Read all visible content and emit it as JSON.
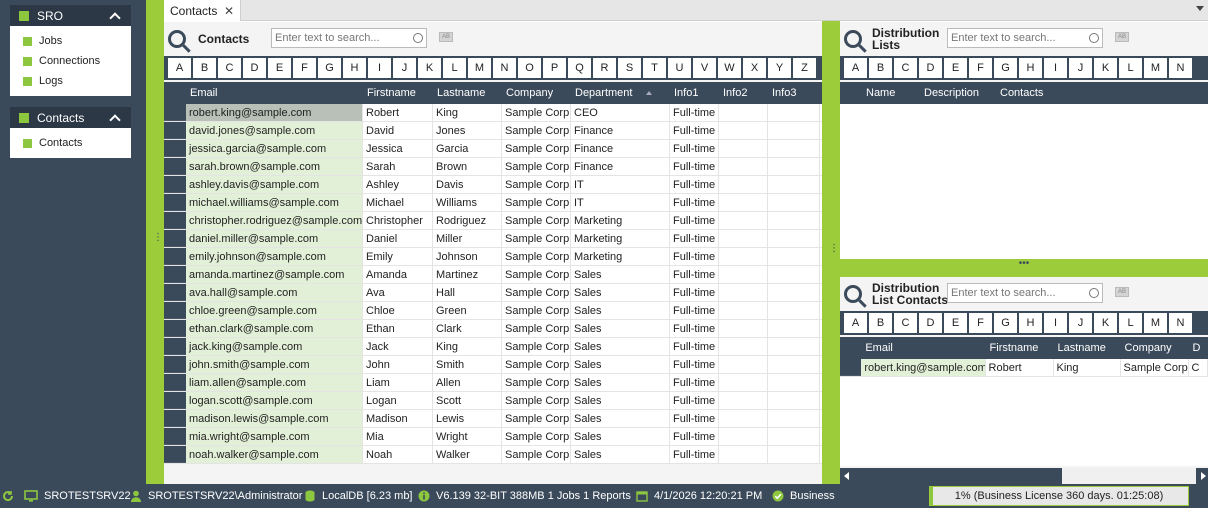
{
  "sidebar": {
    "groups": [
      {
        "title": "SRO",
        "items": [
          "Jobs",
          "Connections",
          "Logs"
        ]
      },
      {
        "title": "Contacts",
        "items": [
          "Contacts"
        ]
      }
    ]
  },
  "tabs": [
    {
      "label": "Contacts",
      "close": "✕"
    }
  ],
  "contacts_panel": {
    "title": "Contacts",
    "search_placeholder": "Enter text to search...",
    "ab": "AB",
    "letters": [
      "A",
      "B",
      "C",
      "D",
      "E",
      "F",
      "G",
      "H",
      "I",
      "J",
      "K",
      "L",
      "M",
      "N",
      "O",
      "P",
      "Q",
      "R",
      "S",
      "T",
      "U",
      "V",
      "W",
      "X",
      "Y",
      "Z"
    ],
    "columns": [
      "Email",
      "Firstname",
      "Lastname",
      "Company",
      "Department",
      "Info1",
      "Info2",
      "Info3"
    ],
    "rows": [
      [
        "robert.king@sample.com",
        "Robert",
        "King",
        "Sample Corp",
        "CEO",
        "Full-time"
      ],
      [
        "david.jones@sample.com",
        "David",
        "Jones",
        "Sample Corp",
        "Finance",
        "Full-time"
      ],
      [
        "jessica.garcia@sample.com",
        "Jessica",
        "Garcia",
        "Sample Corp",
        "Finance",
        "Full-time"
      ],
      [
        "sarah.brown@sample.com",
        "Sarah",
        "Brown",
        "Sample Corp",
        "Finance",
        "Full-time"
      ],
      [
        "ashley.davis@sample.com",
        "Ashley",
        "Davis",
        "Sample Corp",
        "IT",
        "Full-time"
      ],
      [
        "michael.williams@sample.com",
        "Michael",
        "Williams",
        "Sample Corp",
        "IT",
        "Full-time"
      ],
      [
        "christopher.rodriguez@sample.com",
        "Christopher",
        "Rodriguez",
        "Sample Corp",
        "Marketing",
        "Full-time"
      ],
      [
        "daniel.miller@sample.com",
        "Daniel",
        "Miller",
        "Sample Corp",
        "Marketing",
        "Full-time"
      ],
      [
        "emily.johnson@sample.com",
        "Emily",
        "Johnson",
        "Sample Corp",
        "Marketing",
        "Full-time"
      ],
      [
        "amanda.martinez@sample.com",
        "Amanda",
        "Martinez",
        "Sample Corp",
        "Sales",
        "Full-time"
      ],
      [
        "ava.hall@sample.com",
        "Ava",
        "Hall",
        "Sample Corp",
        "Sales",
        "Full-time"
      ],
      [
        "chloe.green@sample.com",
        "Chloe",
        "Green",
        "Sample Corp",
        "Sales",
        "Full-time"
      ],
      [
        "ethan.clark@sample.com",
        "Ethan",
        "Clark",
        "Sample Corp",
        "Sales",
        "Full-time"
      ],
      [
        "jack.king@sample.com",
        "Jack",
        "King",
        "Sample Corp",
        "Sales",
        "Full-time"
      ],
      [
        "john.smith@sample.com",
        "John",
        "Smith",
        "Sample Corp",
        "Sales",
        "Full-time"
      ],
      [
        "liam.allen@sample.com",
        "Liam",
        "Allen",
        "Sample Corp",
        "Sales",
        "Full-time"
      ],
      [
        "logan.scott@sample.com",
        "Logan",
        "Scott",
        "Sample Corp",
        "Sales",
        "Full-time"
      ],
      [
        "madison.lewis@sample.com",
        "Madison",
        "Lewis",
        "Sample Corp",
        "Sales",
        "Full-time"
      ],
      [
        "mia.wright@sample.com",
        "Mia",
        "Wright",
        "Sample Corp",
        "Sales",
        "Full-time"
      ],
      [
        "noah.walker@sample.com",
        "Noah",
        "Walker",
        "Sample Corp",
        "Sales",
        "Full-time"
      ]
    ]
  },
  "dist_lists_panel": {
    "title_line1": "Distribution",
    "title_line2": "Lists",
    "search_placeholder": "Enter text to search...",
    "ab": "AB",
    "letters": [
      "A",
      "B",
      "C",
      "D",
      "E",
      "F",
      "G",
      "H",
      "I",
      "J",
      "K",
      "L",
      "M",
      "N"
    ],
    "columns": [
      "Name",
      "Description",
      "Contacts"
    ]
  },
  "dist_contacts_panel": {
    "title_line1": "Distribution",
    "title_line2": "List Contacts",
    "search_placeholder": "Enter text to search...",
    "ab": "AB",
    "letters": [
      "A",
      "B",
      "C",
      "D",
      "E",
      "F",
      "G",
      "H",
      "I",
      "J",
      "K",
      "L",
      "M",
      "N"
    ],
    "columns": [
      "Email",
      "Firstname",
      "Lastname",
      "Company",
      "D"
    ],
    "rows": [
      [
        "robert.king@sample.com",
        "Robert",
        "King",
        "Sample Corp",
        "C"
      ]
    ]
  },
  "statusbar": {
    "server": "SROTESTSRV22",
    "user": "SROTESTSRV22\\Administrator",
    "db": "LocalDB [6.23 mb]",
    "version": "V6.139 32-BIT 388MB 1 Jobs 1 Reports",
    "datetime": "4/1/2026 12:20:21 PM",
    "license_type": "Business",
    "progress_text": "1% (Business License 360 days. 01:25:08)",
    "progress_fraction": 0.01
  },
  "colors": {
    "accent": "#8dc63f",
    "dark": "#3b4a5a"
  }
}
